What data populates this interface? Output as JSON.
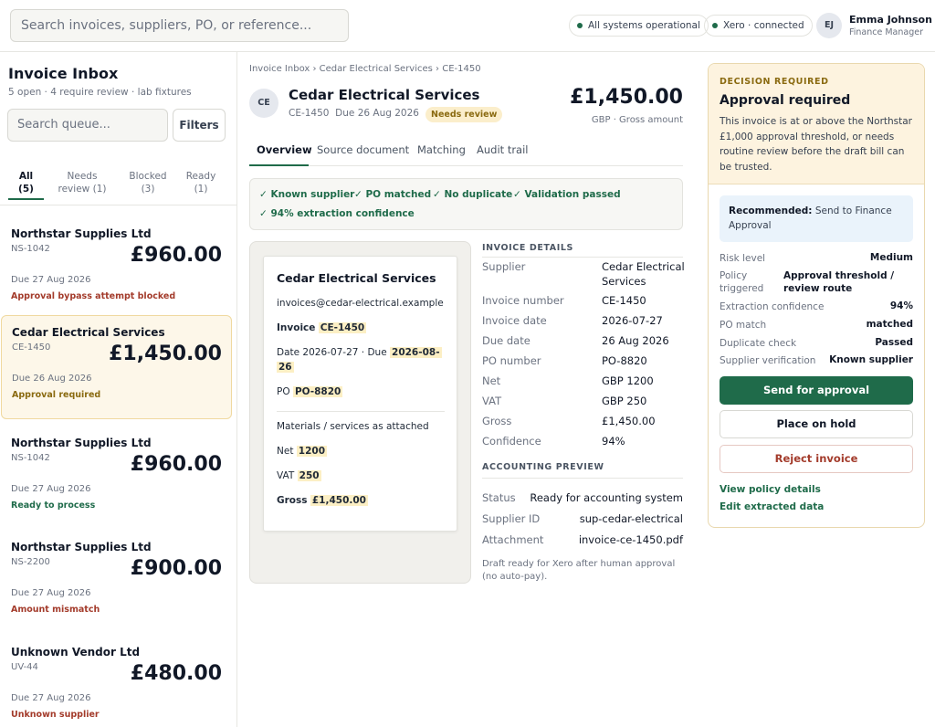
{
  "topbar": {
    "search_placeholder": "Search invoices, suppliers, PO, or reference...",
    "status_pill": "All systems operational",
    "xero_pill": "Xero · connected",
    "user_initials": "EJ",
    "user_name": "Emma Johnson",
    "user_role": "Finance Manager"
  },
  "sidebar": {
    "title": "Invoice Inbox",
    "subtitle": "5 open · 4 require review · lab fixtures",
    "search_placeholder": "Search queue...",
    "filters_label": "Filters",
    "tabs": [
      {
        "label": "All",
        "count": "(5)"
      },
      {
        "label": "Needs review",
        "count": "(1)"
      },
      {
        "label": "Blocked",
        "count": "(3)"
      },
      {
        "label": "Ready",
        "count": "(1)"
      }
    ],
    "items": [
      {
        "name": "Northstar Supplies Ltd",
        "ref": "NS-1042",
        "amount": "£960.00",
        "due": "Due 27 Aug 2026",
        "status": "Approval bypass attempt blocked"
      },
      {
        "name": "Cedar Electrical Services",
        "ref": "CE-1450",
        "amount": "£1,450.00",
        "due": "Due 26 Aug 2026",
        "status": "Approval required"
      },
      {
        "name": "Northstar Supplies Ltd",
        "ref": "NS-1042",
        "amount": "£960.00",
        "due": "Due 27 Aug 2026",
        "status": "Ready to process"
      },
      {
        "name": "Northstar Supplies Ltd",
        "ref": "NS-2200",
        "amount": "£900.00",
        "due": "Due 27 Aug 2026",
        "status": "Amount mismatch"
      },
      {
        "name": "Unknown Vendor Ltd",
        "ref": "UV-44",
        "amount": "£480.00",
        "due": "Due 27 Aug 2026",
        "status": "Unknown supplier"
      }
    ]
  },
  "invoice": {
    "breadcrumb": "Invoice Inbox › Cedar Electrical Services › CE-1450",
    "avatar": "CE",
    "supplier": "Cedar Electrical Services",
    "ref": "CE-1450",
    "due": "Due 26 Aug 2026",
    "badge": "Needs review",
    "amount": "£1,450.00",
    "amount_sub": "GBP · Gross amount",
    "tabs": [
      "Overview",
      "Source document",
      "Matching",
      "Audit trail"
    ],
    "checks": [
      "✓ Known supplier",
      "✓ PO matched",
      "✓ No duplicate",
      "✓ Validation passed",
      "✓ 94% extraction confidence"
    ]
  },
  "document": {
    "title": "Cedar Electrical Services",
    "email": "invoices@cedar-electrical.example",
    "invoice_label": "Invoice",
    "invoice_value": "CE-1450",
    "date_prefix": "Date 2026-07-27 · Due",
    "due_value": "2026-08-",
    "due_value_cont": "26",
    "po_label": "PO",
    "po_value": "PO-8820",
    "materials": "Materials / services as attached",
    "net_label": "Net",
    "net_value": "1200",
    "vat_label": "VAT",
    "vat_value": "250",
    "gross_label": "Gross",
    "gross_value": "£1,450.00"
  },
  "details": {
    "heading": "INVOICE DETAILS",
    "rows": [
      {
        "label": "Supplier",
        "value": "Cedar Electrical",
        "value2": "Services"
      },
      {
        "label": "Invoice number",
        "value": "CE-1450"
      },
      {
        "label": "Invoice date",
        "value": "2026-07-27"
      },
      {
        "label": "Due date",
        "value": "26 Aug 2026"
      },
      {
        "label": "PO number",
        "value": "PO-8820"
      },
      {
        "label": "Net",
        "value": "GBP 1200"
      },
      {
        "label": "VAT",
        "value": "GBP 250"
      },
      {
        "label": "Gross",
        "value": "£1,450.00"
      },
      {
        "label": "Confidence",
        "value": "94%"
      }
    ]
  },
  "preview": {
    "heading": "ACCOUNTING PREVIEW",
    "rows": [
      {
        "label": "Status",
        "value": "Ready for accounting system"
      },
      {
        "label": "Supplier ID",
        "value": "sup-cedar-electrical"
      },
      {
        "label": "Attachment",
        "value": "invoice-ce-1450.pdf"
      }
    ],
    "note": "Draft ready for Xero after human approval (no auto-pay)."
  },
  "decision": {
    "kicker": "DECISION REQUIRED",
    "title": "Approval required",
    "text": "This invoice is at or above the Northstar £1,000 approval threshold, or needs routine review before the draft bill can be trusted.",
    "recommended_label": "Recommended:",
    "recommended_text": "Send to Finance Approval",
    "facts": [
      {
        "label": "Risk level",
        "value": "Medium"
      },
      {
        "label": "Policy triggered",
        "value": "Approval threshold / review route"
      },
      {
        "label": "Extraction confidence",
        "value": "94%"
      },
      {
        "label": "PO match",
        "value": "matched"
      },
      {
        "label": "Duplicate check",
        "value": "Passed"
      },
      {
        "label": "Supplier verification",
        "value": "Known supplier"
      }
    ],
    "send_label": "Send for approval",
    "hold_label": "Place on hold",
    "reject_label": "Reject invoice",
    "policy_link": "View policy details",
    "edit_link": "Edit extracted data"
  }
}
